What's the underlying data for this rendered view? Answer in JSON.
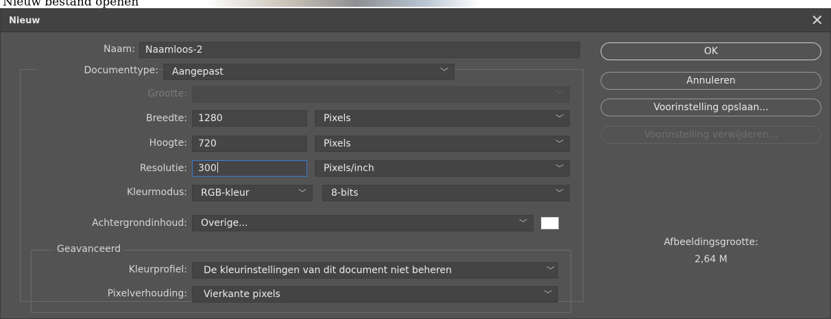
{
  "page_caption": "Nieuw bestand openen",
  "dialog": {
    "title": "Nieuw",
    "close_glyph": "✕"
  },
  "form": {
    "naam": {
      "label": "Naam:",
      "value": "Naamloos-2"
    },
    "documenttype": {
      "label": "Documenttype:",
      "value": "Aangepast"
    },
    "grootte": {
      "label": "Grootte:",
      "value": ""
    },
    "breedte": {
      "label": "Breedte:",
      "value": "1280",
      "unit": "Pixels"
    },
    "hoogte": {
      "label": "Hoogte:",
      "value": "720",
      "unit": "Pixels"
    },
    "resolutie": {
      "label": "Resolutie:",
      "value": "300",
      "unit": "Pixels/inch"
    },
    "kleurmodus": {
      "label": "Kleurmodus:",
      "mode": "RGB-kleur",
      "depth": "8-bits"
    },
    "achtergrond": {
      "label": "Achtergrondinhoud:",
      "value": "Overige...",
      "swatch_color": "#ffffff"
    }
  },
  "advanced": {
    "legend": "Geavanceerd",
    "kleurprofiel": {
      "label": "Kleurprofiel:",
      "value": "De kleurinstellingen van dit document niet beheren"
    },
    "pixelverhouding": {
      "label": "Pixelverhouding:",
      "value": "Vierkante pixels"
    }
  },
  "buttons": {
    "ok": "OK",
    "annuleren": "Annuleren",
    "opslaan": "Voorinstelling opslaan...",
    "verwijderen": "Voorinstelling verwijderen..."
  },
  "image_size": {
    "label": "Afbeeldingsgrootte:",
    "value": "2,64 M"
  },
  "icons": {
    "chevron": "chevron-down-icon",
    "close": "close-icon"
  }
}
